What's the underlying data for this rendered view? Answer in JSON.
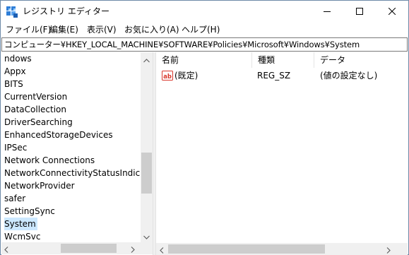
{
  "window": {
    "title": "レジストリ エディター",
    "icon": "regedit-icon",
    "controls": {
      "minimize": "minimize-icon",
      "maximize": "maximize-icon",
      "close": "close-icon"
    }
  },
  "menu": {
    "file": "ファイル(F)",
    "edit": "編集(E)",
    "view": "表示(V)",
    "favorites": "お気に入り(A)",
    "help": "ヘルプ(H)"
  },
  "address": {
    "path": "コンピューター¥HKEY_LOCAL_MACHINE¥SOFTWARE¥Policies¥Microsoft¥Windows¥System"
  },
  "tree": {
    "items": [
      {
        "label": "ndows"
      },
      {
        "label": "Appx"
      },
      {
        "label": "BITS"
      },
      {
        "label": "CurrentVersion"
      },
      {
        "label": "DataCollection"
      },
      {
        "label": "DriverSearching"
      },
      {
        "label": "EnhancedStorageDevices"
      },
      {
        "label": "IPSec"
      },
      {
        "label": "Network Connections"
      },
      {
        "label": "NetworkConnectivityStatusIndicator"
      },
      {
        "label": "NetworkProvider"
      },
      {
        "label": "safer"
      },
      {
        "label": "SettingSync"
      },
      {
        "label": "System"
      },
      {
        "label": "WcmSvc"
      }
    ],
    "selected": "System"
  },
  "list": {
    "columns": {
      "name": "名前",
      "type": "種類",
      "data": "データ"
    },
    "rows": [
      {
        "icon": "string-value-icon",
        "name": "(既定)",
        "type": "REG_SZ",
        "data": "(値の設定なし)"
      }
    ]
  },
  "colors": {
    "selection": "#cce8ff",
    "scrollbar_track": "#f0f0f0",
    "scrollbar_thumb": "#cdcdcd",
    "string_icon_red": "#d9382c"
  }
}
